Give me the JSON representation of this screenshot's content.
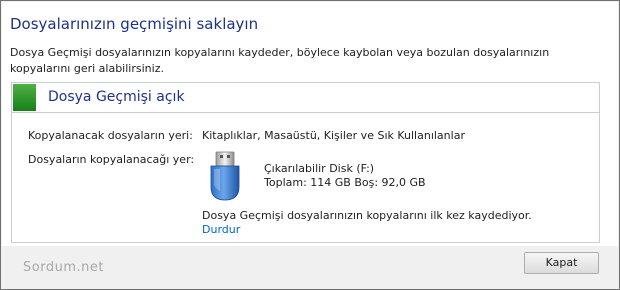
{
  "dialog": {
    "heading": "Dosyalarınızın geçmişini saklayın",
    "description": "Dosya Geçmişi dosyalarınızın kopyalarını kaydeder, böylece kaybolan veya bozulan dosyalarınızın kopyalarını geri alabilirsiniz."
  },
  "panel": {
    "status_title": "Dosya Geçmişi açık",
    "status_color": "#2b9a2a",
    "source_label": "Kopyalanacak dosyaların yeri:",
    "source_value": "Kitaplıklar, Masaüstü, Kişiler ve Sık Kullanılanlar",
    "target_label": "Dosyaların kopyalanacağı yer:",
    "drive": {
      "icon": "usb-drive-icon",
      "name": "Çıkarılabilir Disk (F:)",
      "space": "Toplam: 114 GB Boş: 92,0 GB"
    },
    "progress_message": "Dosya Geçmişi dosyalarınızın kopyalarını ilk kez kaydediyor.",
    "stop_link": "Durdur"
  },
  "footer": {
    "watermark": "Sordum.net",
    "close_button": "Kapat"
  }
}
